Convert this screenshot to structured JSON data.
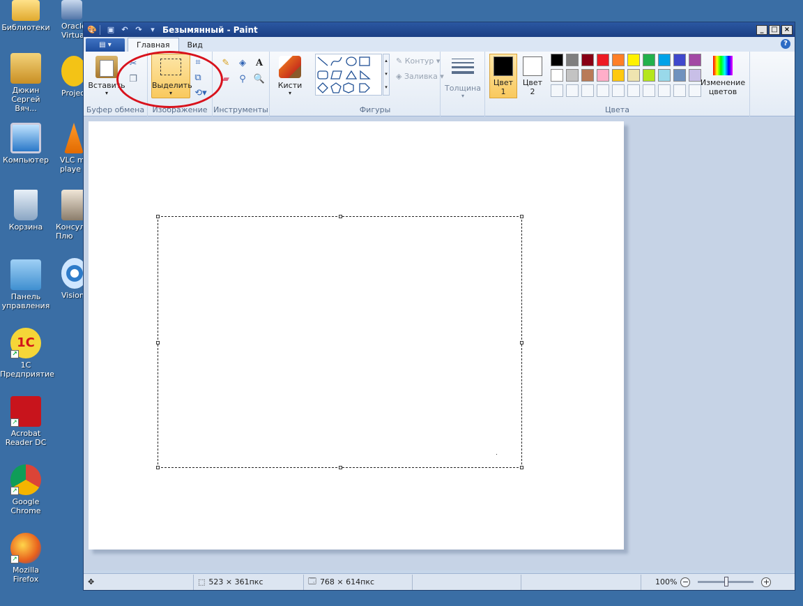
{
  "desktop": {
    "col1": [
      {
        "label": "Библиотеки"
      },
      {
        "label": "Дюкин Сергей Вяч..."
      },
      {
        "label": "Компьютер"
      },
      {
        "label": "Корзина"
      },
      {
        "label": "Панель управления"
      },
      {
        "label": "1С Предприятие"
      },
      {
        "label": "Acrobat Reader DC"
      },
      {
        "label": "Google Chrome"
      },
      {
        "label": "Mozilla Firefox"
      }
    ],
    "col2": [
      {
        "label": "Oracle Virtual"
      },
      {
        "label": "Project E"
      },
      {
        "label": "VLC me playe"
      },
      {
        "label": "Консуль Плю"
      },
      {
        "label": "Vision бита"
      }
    ]
  },
  "window": {
    "title": "Безымянный - Paint",
    "controls": {
      "minimize": "_",
      "maximize": "□",
      "close": "×"
    }
  },
  "tabs": {
    "home": "Главная",
    "view": "Вид"
  },
  "ribbon": {
    "clipboard": {
      "label": "Буфер обмена",
      "paste": "Вставить"
    },
    "image": {
      "label": "Изображение",
      "select": "Выделить"
    },
    "tools": {
      "label": "Инструменты"
    },
    "brushes": "Кисти",
    "shapes": {
      "label": "Фигуры",
      "outline": "Контур",
      "fill": "Заливка"
    },
    "size": "Толщина",
    "colors": {
      "label": "Цвета",
      "color1": "Цвет 1",
      "color2": "Цвет 2",
      "edit": "Изменение цветов",
      "color1_value": "#000000",
      "color2_value": "#ffffff",
      "palette_row1": [
        "#000000",
        "#7f7f7f",
        "#880015",
        "#ed1c24",
        "#ff7f27",
        "#fff200",
        "#22b14c",
        "#00a2e8",
        "#3f48cc",
        "#a349a4"
      ],
      "palette_row2": [
        "#ffffff",
        "#c3c3c3",
        "#b97a57",
        "#ffaec9",
        "#ffc90e",
        "#efe4b0",
        "#b5e61d",
        "#99d9ea",
        "#7092be",
        "#c8bfe7"
      ]
    }
  },
  "annotation": {
    "color": "#d8121c"
  },
  "status": {
    "selection_size": "523 × 361пкс",
    "image_size": "768 × 614пкс",
    "zoom": "100%"
  }
}
